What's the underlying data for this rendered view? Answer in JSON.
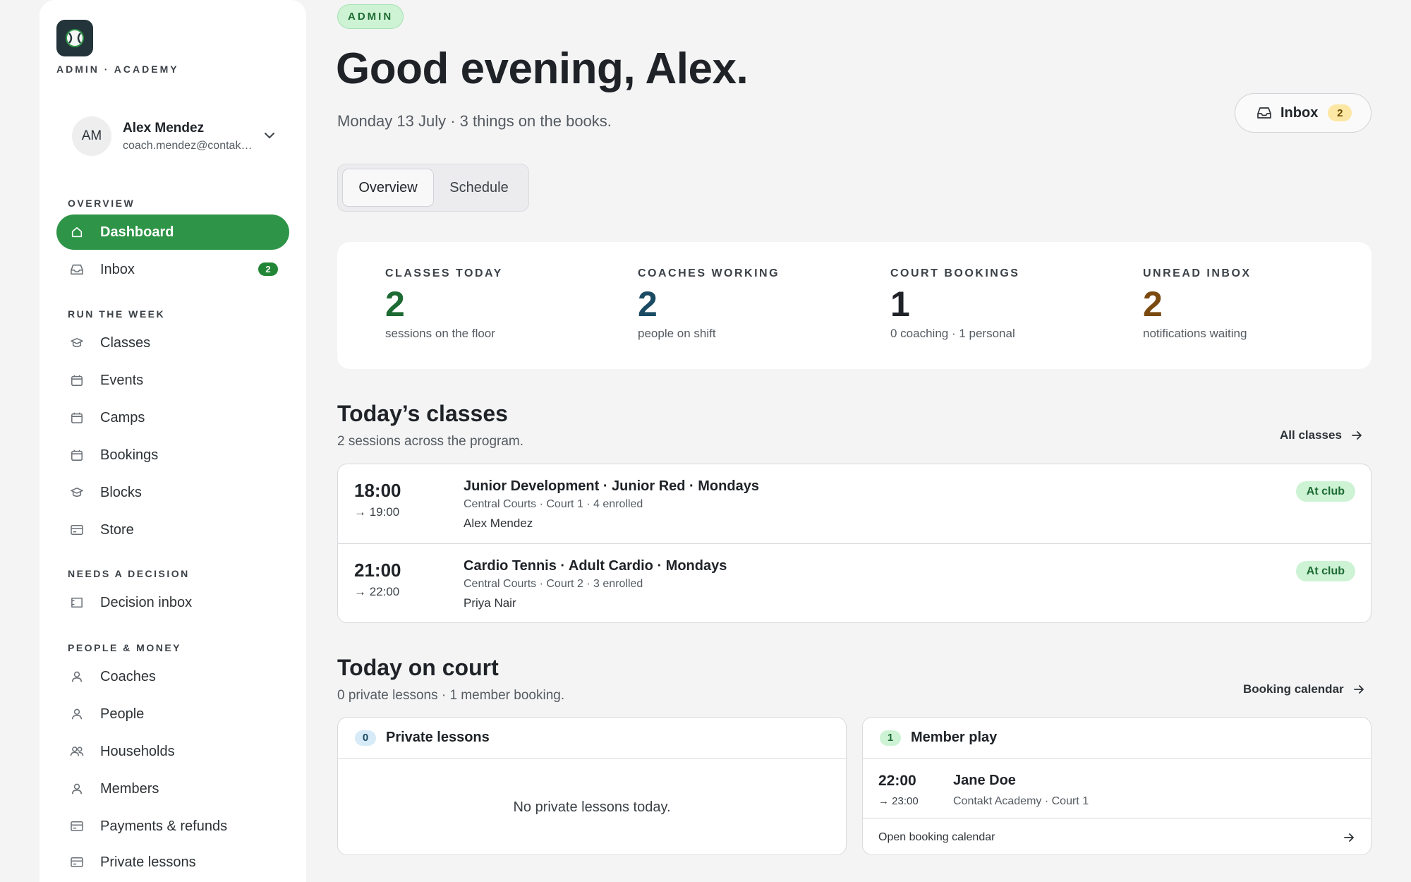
{
  "brand": {
    "label": "ADMIN · ACADEMY"
  },
  "user": {
    "initials": "AM",
    "name": "Alex Mendez",
    "email": "coach.mendez@contakt.academy"
  },
  "sidebar": {
    "sections": [
      {
        "label": "OVERVIEW"
      },
      {
        "label": "RUN THE WEEK"
      },
      {
        "label": "NEEDS A DECISION"
      },
      {
        "label": "PEOPLE & MONEY"
      }
    ],
    "items": [
      {
        "label": "Dashboard",
        "icon": "home-icon"
      },
      {
        "label": "Inbox",
        "icon": "inbox-icon",
        "badge": "2"
      },
      {
        "label": "Classes",
        "icon": "classes-icon"
      },
      {
        "label": "Events",
        "icon": "calendar-icon"
      },
      {
        "label": "Camps",
        "icon": "calendar-icon"
      },
      {
        "label": "Bookings",
        "icon": "calendar-icon"
      },
      {
        "label": "Blocks",
        "icon": "blocks-icon"
      },
      {
        "label": "Store",
        "icon": "store-icon"
      },
      {
        "label": "Decision inbox",
        "icon": "decision-icon"
      },
      {
        "label": "Coaches",
        "icon": "user-icon"
      },
      {
        "label": "People",
        "icon": "user-icon"
      },
      {
        "label": "Households",
        "icon": "users-icon"
      },
      {
        "label": "Members",
        "icon": "user-icon"
      },
      {
        "label": "Payments & refunds",
        "icon": "card-icon"
      },
      {
        "label": "Private lessons",
        "icon": "card-icon"
      }
    ]
  },
  "header": {
    "pill": "ADMIN",
    "greeting": "Good evening, Alex.",
    "subtitle": "Monday 13 July · 3 things on the books.",
    "inbox_label": "Inbox",
    "inbox_count": "2"
  },
  "tabs": [
    {
      "label": "Overview"
    },
    {
      "label": "Schedule"
    }
  ],
  "stats": [
    {
      "label": "CLASSES TODAY",
      "value": "2",
      "sub": "sessions on the floor",
      "color": "#1d6b33"
    },
    {
      "label": "COACHES WORKING",
      "value": "2",
      "sub": "people on shift",
      "color": "#1b4a63"
    },
    {
      "label": "COURT BOOKINGS",
      "value": "1",
      "sub": "0 coaching · 1 personal",
      "color": "#1f2328"
    },
    {
      "label": "UNREAD INBOX",
      "value": "2",
      "sub": "notifications waiting",
      "color": "#7a4a10"
    }
  ],
  "classes": {
    "title": "Today’s classes",
    "subtitle": "2 sessions across the program.",
    "link": "All classes",
    "rows": [
      {
        "start": "18:00",
        "end": "→ 19:00",
        "title": "Junior Development · Junior Red · Mondays",
        "meta": "Central Courts · Court 1 · 4 enrolled",
        "coach": "Alex Mendez",
        "badge": "At club"
      },
      {
        "start": "21:00",
        "end": "→ 22:00",
        "title": "Cardio Tennis · Adult Cardio · Mondays",
        "meta": "Central Courts · Court 2 · 3 enrolled",
        "coach": "Priya Nair",
        "badge": "At club"
      }
    ]
  },
  "court": {
    "title": "Today on court",
    "subtitle": "0 private lessons · 1 member booking.",
    "link": "Booking calendar",
    "private": {
      "count": "0",
      "title": "Private lessons",
      "empty": "No private lessons today."
    },
    "member": {
      "count": "1",
      "title": "Member play",
      "booking": {
        "start": "22:00",
        "end": "→ 23:00",
        "name": "Jane Doe",
        "place": "Contakt Academy · Court 1"
      },
      "footer": "Open booking calendar"
    }
  }
}
